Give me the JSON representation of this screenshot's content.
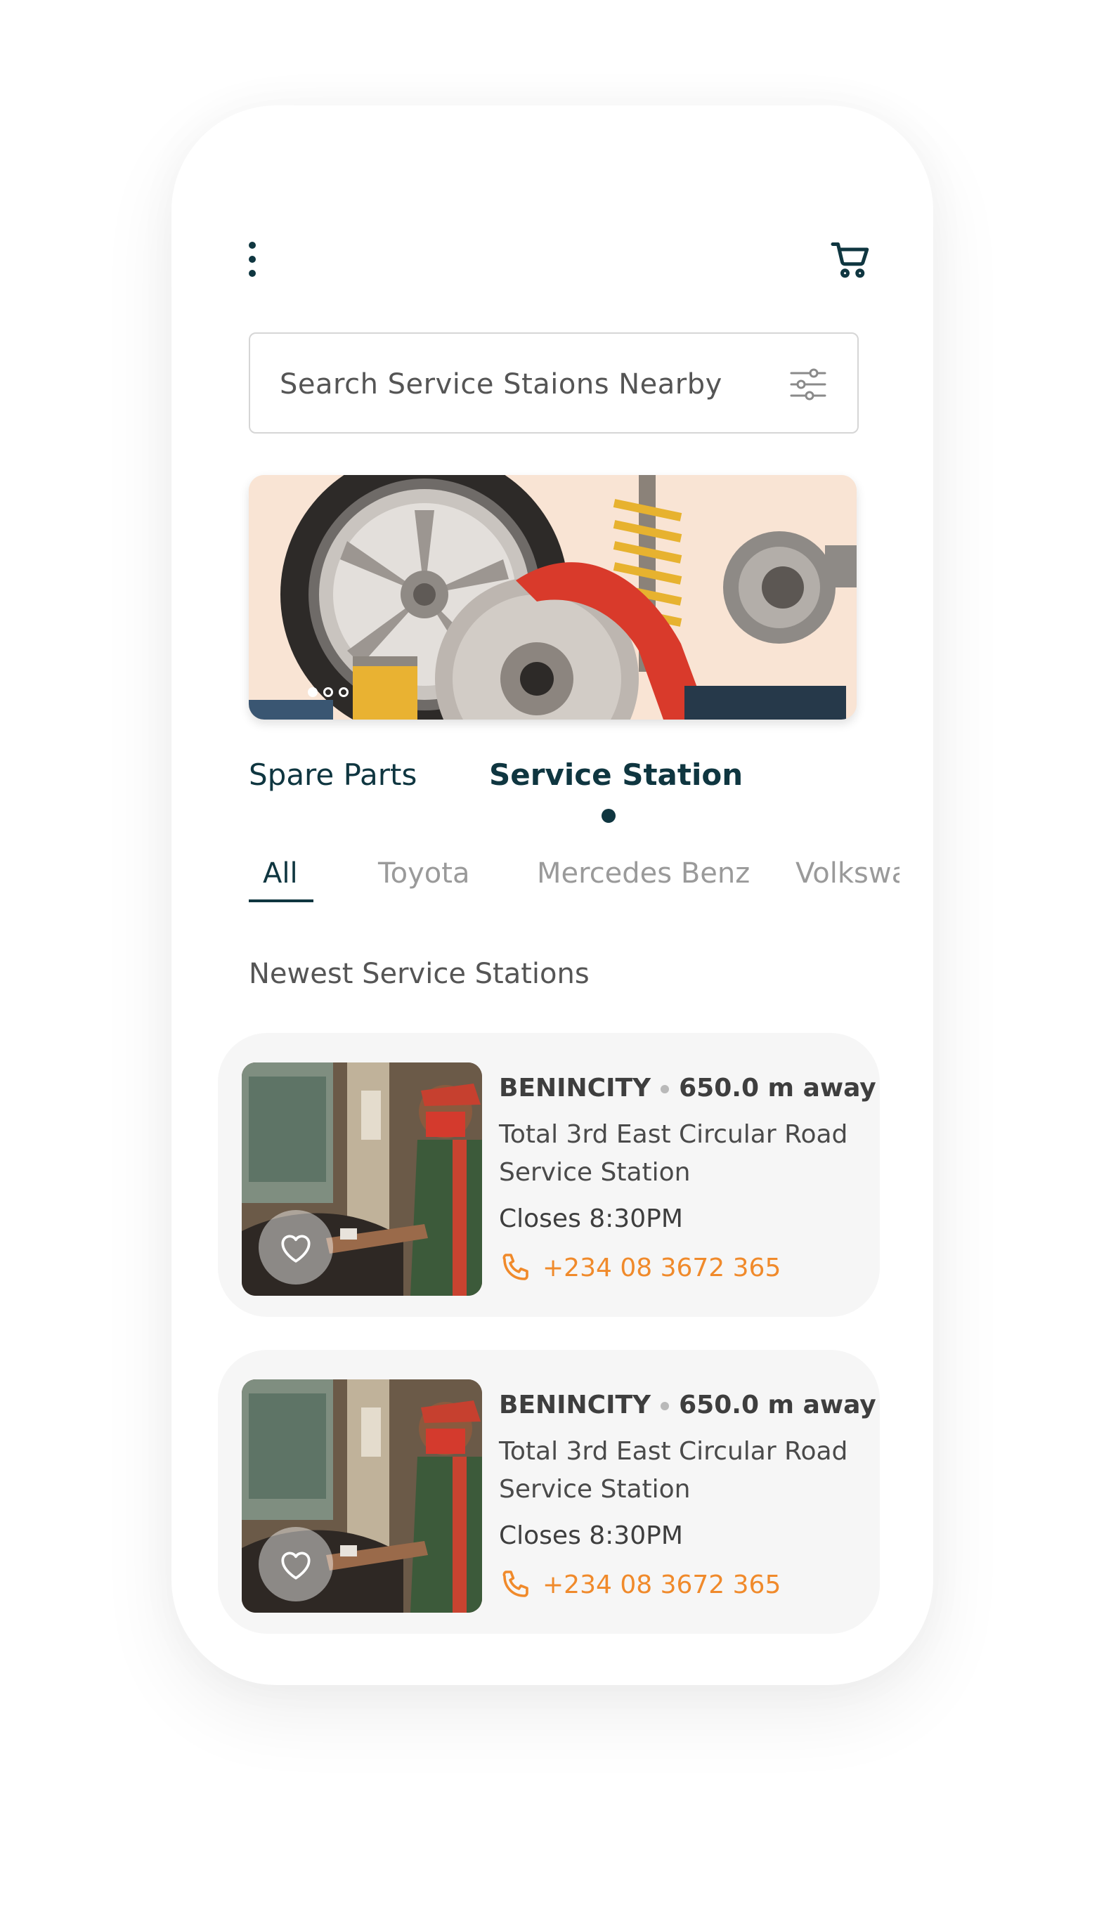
{
  "header": {
    "menu_icon": "more-vertical-icon",
    "cart_icon": "shopping-cart-icon"
  },
  "search": {
    "placeholder": "Search Service Staions Nearby",
    "filter_icon": "sliders-icon"
  },
  "banner": {
    "image": "auto-spare-parts-banner",
    "dots_count": 3,
    "active_dot": 1
  },
  "main_tabs": [
    {
      "label": "Spare Parts",
      "active": false
    },
    {
      "label": "Service Station",
      "active": true
    }
  ],
  "brand_tabs": [
    {
      "label": "All",
      "active": true
    },
    {
      "label": "Toyota",
      "active": false
    },
    {
      "label": "Mercedes Benz",
      "active": false
    },
    {
      "label": "Volkswa",
      "active": false
    }
  ],
  "section_title": "Newest Service Stations",
  "stations": [
    {
      "city": "BENINCITY",
      "distance": "650.0 m away",
      "name": "Total 3rd East Circular Road Service Station",
      "hours": "Closes 8:30PM",
      "phone": "+234 08 3672 365"
    },
    {
      "city": "BENINCITY",
      "distance": "650.0 m away",
      "name": "Total 3rd East Circular Road Service Station",
      "hours": "Closes 8:30PM",
      "phone": "+234 08 3672 365"
    }
  ],
  "colors": {
    "primary": "#0f3640",
    "accent": "#f08a2b",
    "banner_bg": "#f9e4d4",
    "card_bg": "#f6f6f6"
  }
}
